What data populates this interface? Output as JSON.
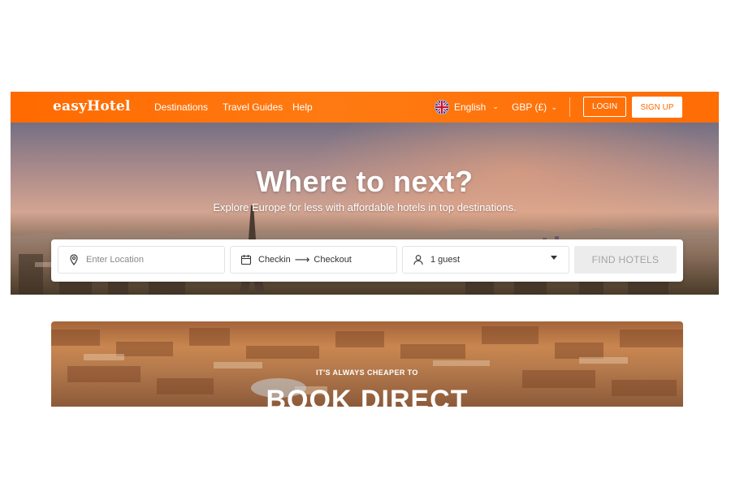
{
  "header": {
    "logo": "easyHotel",
    "nav": [
      "Destinations",
      "Travel Guides",
      "Help"
    ],
    "language": "English",
    "currency": "GBP (£)",
    "login": "LOGIN",
    "signup": "SIGN UP"
  },
  "hero": {
    "title": "Where to next?",
    "subtitle": "Explore Europe for less with affordable hotels in top destinations."
  },
  "search": {
    "location_placeholder": "Enter Location",
    "checkin": "Checkin",
    "checkout": "Checkout",
    "guests": "1 guest",
    "button": "FIND HOTELS"
  },
  "promo": {
    "kicker": "IT'S ALWAYS CHEAPER TO",
    "headline": "BOOK DIRECT"
  },
  "colors": {
    "brand": "#ff6a00",
    "button_disabled": "#ececec"
  },
  "icons": {
    "flag": "uk-flag-icon",
    "location": "map-pin-icon",
    "calendar": "calendar-icon",
    "guest": "person-icon"
  }
}
